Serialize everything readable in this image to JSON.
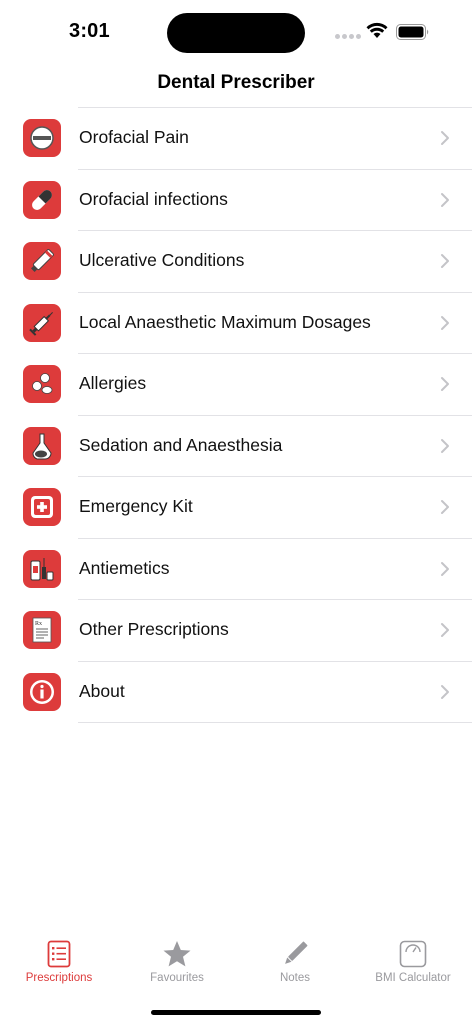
{
  "status_bar": {
    "time": "3:01"
  },
  "nav": {
    "title": "Dental Prescriber"
  },
  "menu": {
    "items": [
      {
        "label": "Orofacial Pain",
        "icon": "no-entry-pill-icon"
      },
      {
        "label": "Orofacial infections",
        "icon": "capsule-icon"
      },
      {
        "label": "Ulcerative Conditions",
        "icon": "tube-icon"
      },
      {
        "label": "Local Anaesthetic Maximum Dosages",
        "icon": "syringe-icon"
      },
      {
        "label": "Allergies",
        "icon": "pills-icon"
      },
      {
        "label": "Sedation and Anaesthesia",
        "icon": "mask-icon"
      },
      {
        "label": "Emergency Kit",
        "icon": "first-aid-icon"
      },
      {
        "label": "Antiemetics",
        "icon": "medicine-bottle-icon"
      },
      {
        "label": "Other Prescriptions",
        "icon": "prescription-pad-icon"
      },
      {
        "label": "About",
        "icon": "info-icon"
      }
    ]
  },
  "tabs": [
    {
      "label": "Prescriptions",
      "icon": "prescription-list-icon",
      "active": true
    },
    {
      "label": "Favourites",
      "icon": "star-icon",
      "active": false
    },
    {
      "label": "Notes",
      "icon": "pencil-icon",
      "active": false
    },
    {
      "label": "BMI Calculator",
      "icon": "scale-icon",
      "active": false
    }
  ],
  "colors": {
    "accent": "#dd3b3b",
    "tab_inactive": "#9a9a9e",
    "chevron": "#c4c4c8"
  }
}
